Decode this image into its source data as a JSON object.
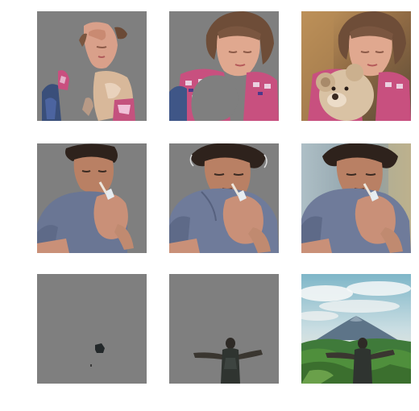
{
  "figure": {
    "background": "#ffffff",
    "mask_gray": "#7f7f7f",
    "rows": [
      {
        "subject": "girl-with-teddy-bear",
        "tiles": [
          {
            "kind": "sparse-mask"
          },
          {
            "kind": "dense-mask"
          },
          {
            "kind": "original"
          }
        ]
      },
      {
        "subject": "man-lighting-cigarette",
        "tiles": [
          {
            "kind": "sparse-mask"
          },
          {
            "kind": "dense-mask"
          },
          {
            "kind": "original"
          }
        ]
      },
      {
        "subject": "person-before-volcano",
        "tiles": [
          {
            "kind": "sparse-mask"
          },
          {
            "kind": "dense-mask"
          },
          {
            "kind": "original"
          }
        ]
      }
    ]
  }
}
